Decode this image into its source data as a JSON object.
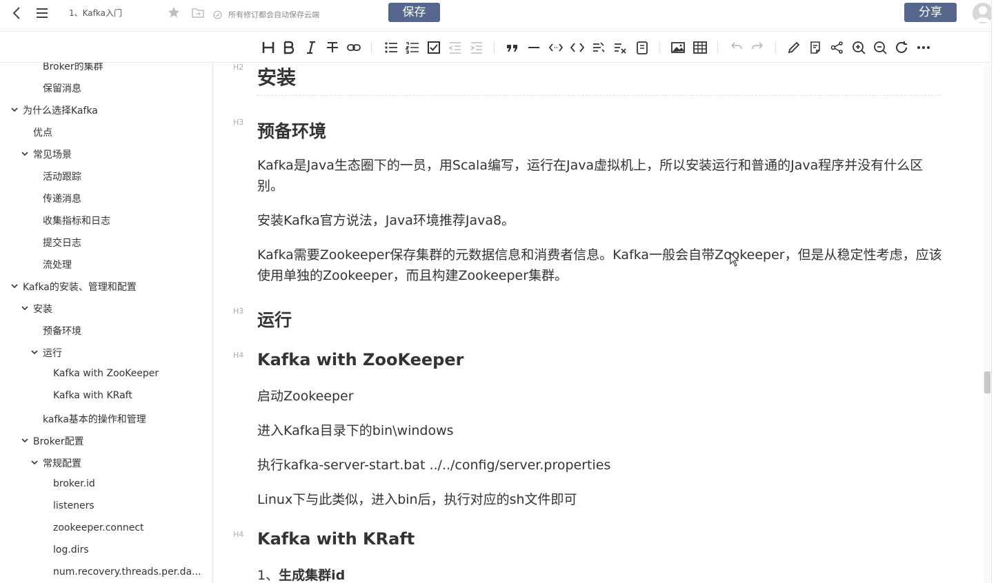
{
  "topbar": {
    "title": "1、Kafka入门",
    "save_status": "所有修订都会自动保存云端",
    "save_label": "保存",
    "share_label": "分享"
  },
  "toolbar": {
    "tools": [
      "heading-icon",
      "bold-icon",
      "italic-icon",
      "strikethrough-icon",
      "link-icon",
      "bullet-list-icon",
      "numbered-list-icon",
      "checkbox-list-icon",
      "outdent-icon",
      "indent-icon",
      "quote-icon",
      "horizontal-rule-icon",
      "inline-code-icon",
      "code-block-icon",
      "text-format-icon",
      "clear-format-icon",
      "snippet-icon",
      "image-icon",
      "table-icon",
      "undo-icon",
      "redo-icon",
      "edit-icon",
      "note-icon",
      "mindmap-icon",
      "zoom-in-icon",
      "zoom-out-icon",
      "refresh-icon",
      "more-icon"
    ]
  },
  "sidebar": {
    "items": [
      {
        "label": "Broker的集群",
        "level": 3,
        "chevron": false
      },
      {
        "label": "保留消息",
        "level": 3,
        "chevron": false
      },
      {
        "label": "为什么选择Kafka",
        "level": 1,
        "chevron": true
      },
      {
        "label": "优点",
        "level": 2,
        "chevron": false
      },
      {
        "label": "常见场景",
        "level": 2,
        "chevron": true
      },
      {
        "label": "活动跟踪",
        "level": 3,
        "chevron": false
      },
      {
        "label": "传递消息",
        "level": 3,
        "chevron": false
      },
      {
        "label": "收集指标和日志",
        "level": 3,
        "chevron": false
      },
      {
        "label": "提交日志",
        "level": 3,
        "chevron": false
      },
      {
        "label": "流处理",
        "level": 3,
        "chevron": false
      },
      {
        "label": "Kafka的安装、管理和配置",
        "level": 1,
        "chevron": true
      },
      {
        "label": "安装",
        "level": 2,
        "chevron": true
      },
      {
        "label": "预备环境",
        "level": 3,
        "chevron": false
      },
      {
        "label": "运行",
        "level": 3,
        "chevron": true
      },
      {
        "label": "Kafka with ZooKeeper",
        "level": 4,
        "chevron": false
      },
      {
        "label": "Kafka with KRaft",
        "level": 4,
        "chevron": false
      },
      {
        "label": "kafka基本的操作和管理",
        "level": 3,
        "chevron": false
      },
      {
        "label": "Broker配置",
        "level": 2,
        "chevron": true
      },
      {
        "label": "常规配置",
        "level": 3,
        "chevron": true
      },
      {
        "label": "broker.id",
        "level": 4,
        "chevron": false
      },
      {
        "label": "listeners",
        "level": 4,
        "chevron": false
      },
      {
        "label": "zookeeper.connect",
        "level": 4,
        "chevron": false
      },
      {
        "label": "log.dirs",
        "level": 4,
        "chevron": false
      },
      {
        "label": "num.recovery.threads.per.da...",
        "level": 4,
        "chevron": false
      }
    ]
  },
  "editor": {
    "h2_label": "H2",
    "h2": "安装",
    "h3a_label": "H3",
    "h3a": "预备环境",
    "p1": "Kafka是Java生态圈下的一员，用Scala编写，运行在Java虚拟机上，所以安装运行和普通的Java程序并没有什么区别。",
    "p2": "安装Kafka官方说法，Java环境推荐Java8。",
    "p3": "Kafka需要Zookeeper保存集群的元数据信息和消费者信息。Kafka一般会自带Zookeeper，但是从稳定性考虑，应该使用单独的Zookeeper，而且构建Zookeeper集群。",
    "h3b_label": "H3",
    "h3b": "运行",
    "h4a_label": "H4",
    "h4a": "Kafka with ZooKeeper",
    "p4": "启动Zookeeper",
    "p5": "进入Kafka目录下的bin\\windows",
    "p6": "执行kafka-server-start.bat ../../config/server.properties",
    "p7": "Linux下与此类似，进入bin后，执行对应的sh文件即可",
    "h4b_label": "H4",
    "h4b": "Kafka with KRaft",
    "list1_num": "1、",
    "list1_text": "生成集群id"
  }
}
